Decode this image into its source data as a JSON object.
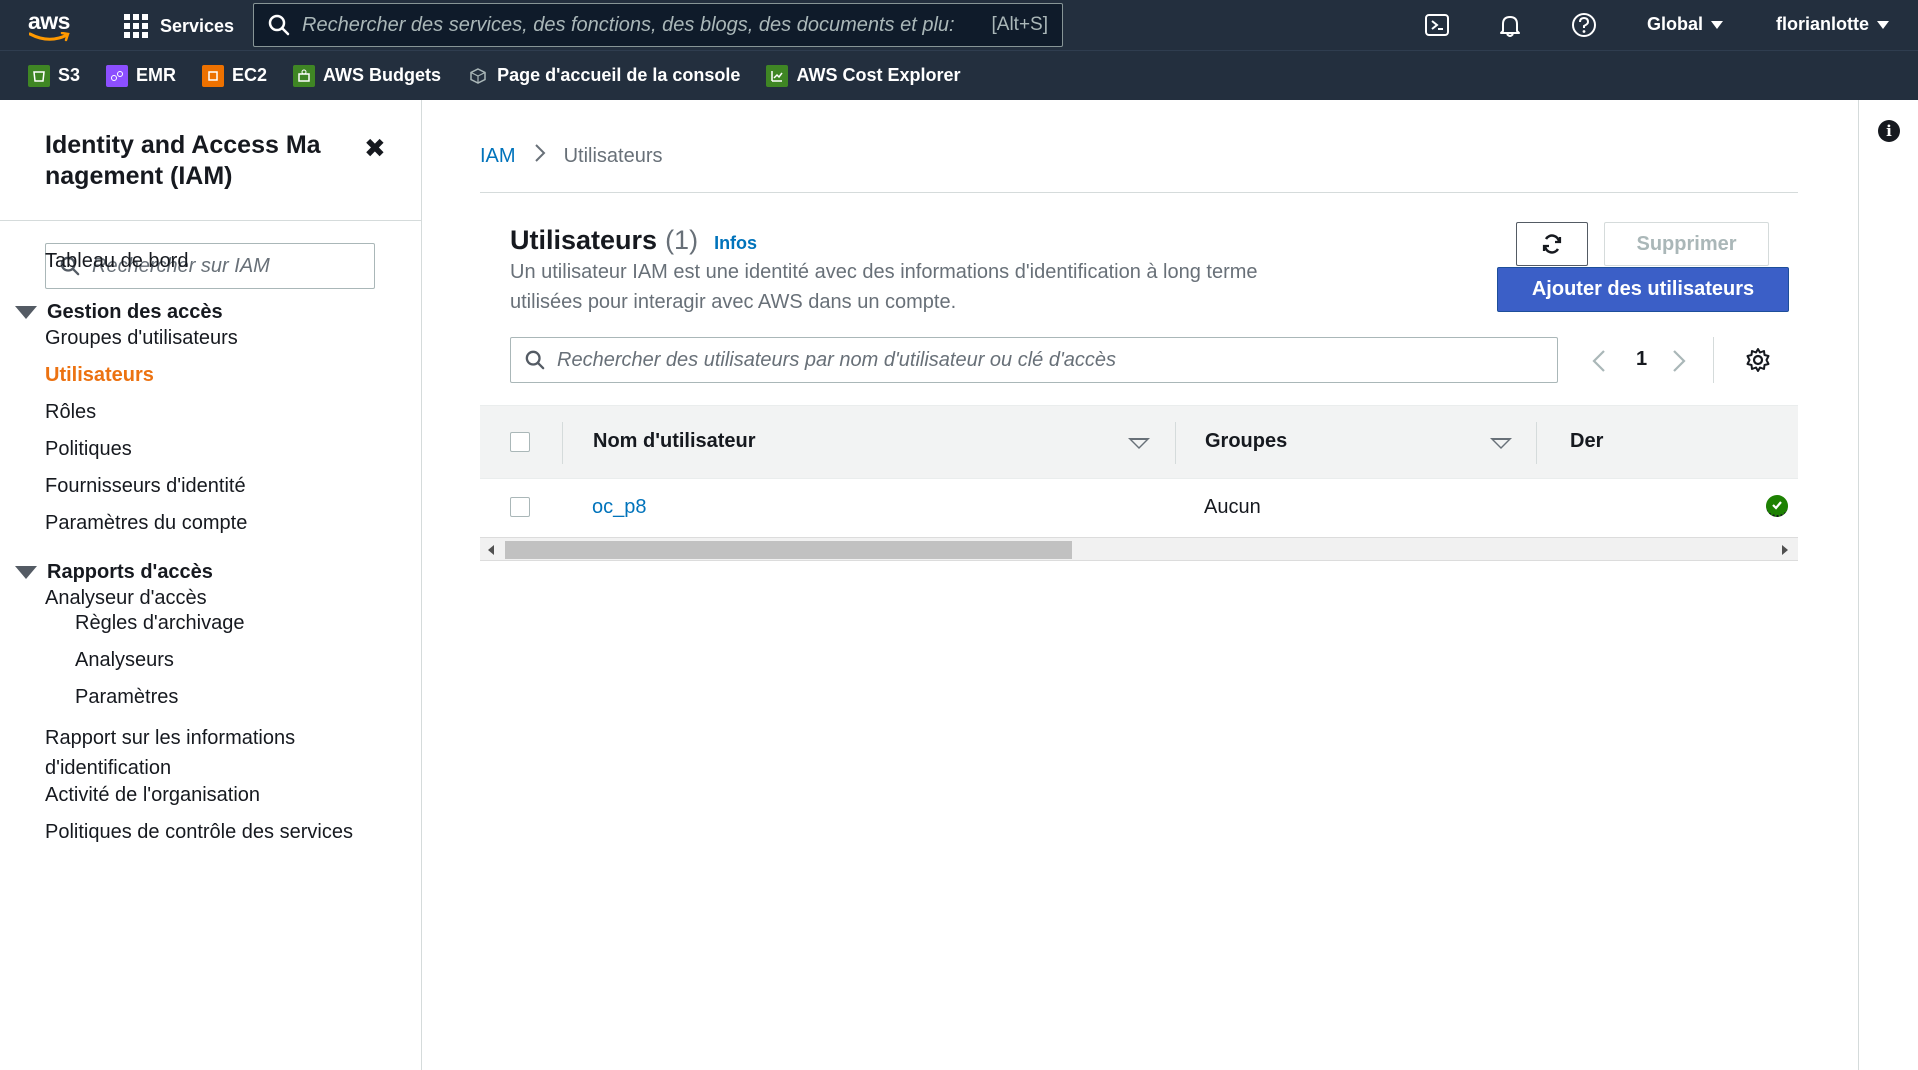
{
  "topbar": {
    "logo_text": "aws",
    "services_label": "Services",
    "search_placeholder": "Rechercher des services, des fonctions, des blogs, des documents et plu:",
    "search_shortcut": "[Alt+S]",
    "region_label": "Global",
    "user_label": "florianlotte",
    "icons": [
      "cloudshell-icon",
      "bell-icon",
      "help-icon"
    ]
  },
  "favorites": [
    {
      "label": "S3",
      "color": "#3f8624"
    },
    {
      "label": "EMR",
      "color": "#8c4fff"
    },
    {
      "label": "EC2",
      "color": "#ed7100"
    },
    {
      "label": "AWS Budgets",
      "color": "#3f8624"
    },
    {
      "label": "Page d'accueil de la console",
      "color": "#545b64"
    },
    {
      "label": "AWS Cost Explorer",
      "color": "#3f8624"
    }
  ],
  "sidebar": {
    "title": "Identity and Access Ma nagement (IAM)",
    "search_placeholder": "Rechercher sur IAM",
    "dashboard": "Tableau de bord",
    "section_access": "Gestion des accès",
    "access_items": [
      "Groupes d'utilisateurs",
      "Utilisateurs",
      "Rôles",
      "Politiques",
      "Fournisseurs d'identité",
      "Paramètres du compte"
    ],
    "section_reports": "Rapports d'accès",
    "analyzer": "Analyseur d'accès",
    "analyzer_items": [
      "Règles d'archivage",
      "Analyseurs",
      "Paramètres"
    ],
    "credential_report_1": "Rapport sur les informations",
    "credential_report_2": "d'identification",
    "org_activity": "Activité de l'organisation",
    "scp": "Politiques de contrôle des services",
    "active_item": "Utilisateurs",
    "accent_color": "#ec7211"
  },
  "breadcrumb": {
    "root": "IAM",
    "current": "Utilisateurs"
  },
  "panel": {
    "title": "Utilisateurs",
    "count": "(1)",
    "info_link": "Infos",
    "description_1": "Un utilisateur IAM est une identité avec des informations d'identification à long terme",
    "description_2": "utilisées pour interagir avec AWS dans un compte.",
    "delete_label": "Supprimer",
    "add_label": "Ajouter des utilisateurs",
    "search_placeholder": "Rechercher des utilisateurs par nom d'utilisateur ou clé d'accès",
    "page": "1",
    "primary_color": "#3b5fc7"
  },
  "table": {
    "columns": [
      "Nom d'utilisateur",
      "Groupes",
      "Der"
    ],
    "rows": [
      {
        "username": "oc_p8",
        "groups": "Aucun",
        "status": "ok"
      }
    ]
  }
}
